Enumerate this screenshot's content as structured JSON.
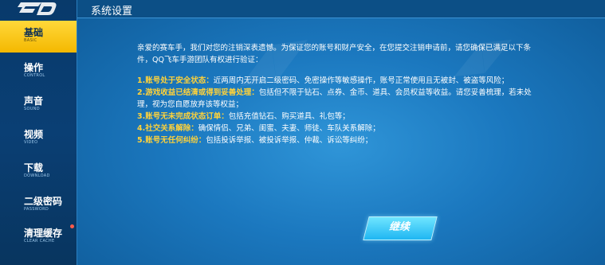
{
  "header": {
    "title": "系统设置"
  },
  "sidebar": {
    "items": [
      {
        "label": "基础",
        "sub": "BASIC",
        "active": true
      },
      {
        "label": "操作",
        "sub": "CONTROL"
      },
      {
        "label": "声音",
        "sub": "SOUND"
      },
      {
        "label": "视频",
        "sub": "VIDEO"
      },
      {
        "label": "下载",
        "sub": "DOWNLOAD"
      },
      {
        "label": "二级密码",
        "sub": "PASSWORD"
      },
      {
        "label": "清理缓存",
        "sub": "CLEAR CACHE",
        "notify": true
      }
    ]
  },
  "main": {
    "intro": "亲爱的赛车手，我们对您的注销深表遗憾。为保证您的账号和财产安全，在您提交注销申请前，请您确保已满足以下条件，QQ飞车手游团队有权进行验证：",
    "conditions": [
      {
        "title": "1.账号处于安全状态：",
        "text": "近两周内无开启二级密码、免密操作等敏感操作，账号正常使用且无被封、被盗等风险；"
      },
      {
        "title": "2.游戏收益已结清或得到妥善处理：",
        "text": "包括但不限于钻石、点券、金币、道具、会员权益等收益。请您妥善梳理，若未处理，视为您自愿放弃该等权益；"
      },
      {
        "title": "3.账号无未完成状态订单：",
        "text": "包括充值钻石、购买道具、礼包等；"
      },
      {
        "title": "4.社交关系解除：",
        "text": "确保情侣、兄弟、闺蜜、夫妻、师徒、车队关系解除；"
      },
      {
        "title": "5.账号无任何纠纷：",
        "text": "包括投诉举报、被投诉举报、仲裁、诉讼等纠纷；"
      }
    ],
    "continue_label": "继续"
  },
  "colors": {
    "accent": "#ffd23a",
    "active_tab": "#f4b800",
    "button": "#1fb6f2",
    "background": "#1b78bf"
  }
}
